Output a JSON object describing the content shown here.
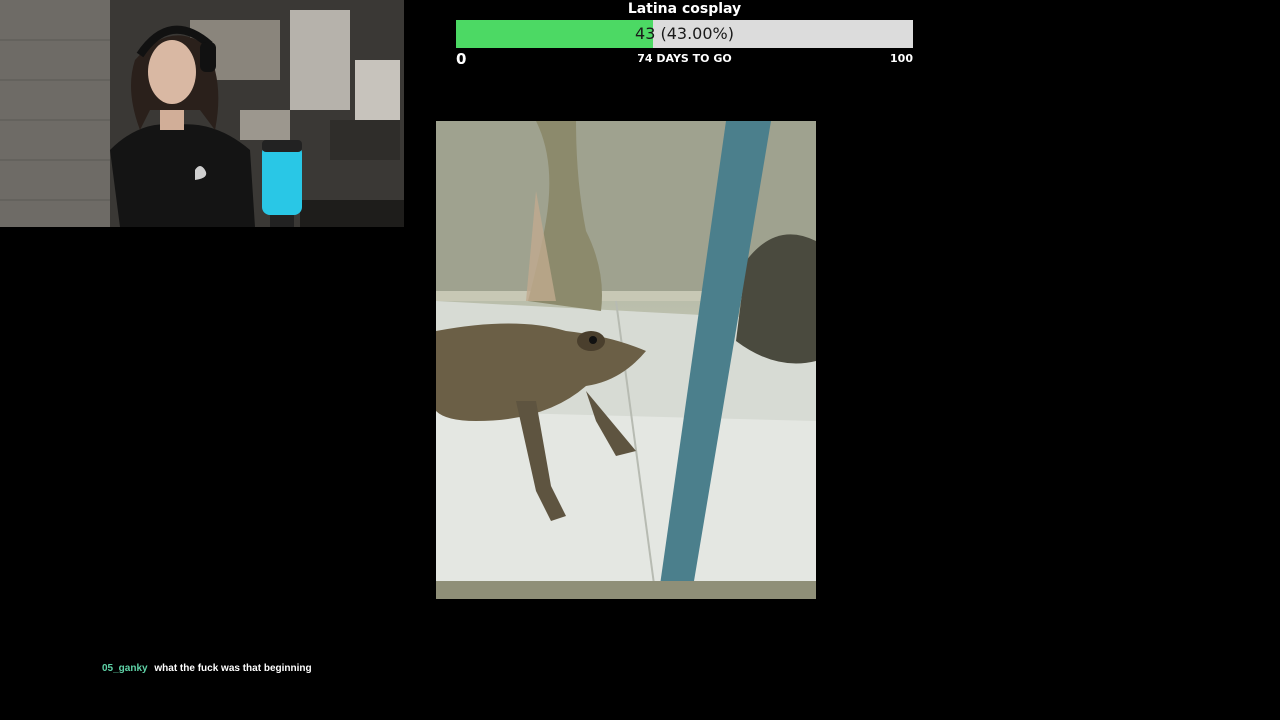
{
  "goal": {
    "title": "Latina cosplay",
    "value_text": "43 (43.00%)",
    "progress_fraction": 0.43,
    "min_label": "0",
    "days_label": "74 DAYS TO GO",
    "max_label": "100",
    "fill_color": "#4cd964",
    "track_color": "#dcdcdc"
  },
  "chat": {
    "username": "05_ganky",
    "message": "what the fuck was that beginning",
    "username_color": "#5fd4a8"
  },
  "webcam": {
    "icon": "webcam-feed"
  },
  "video": {
    "icon": "frog-video"
  }
}
